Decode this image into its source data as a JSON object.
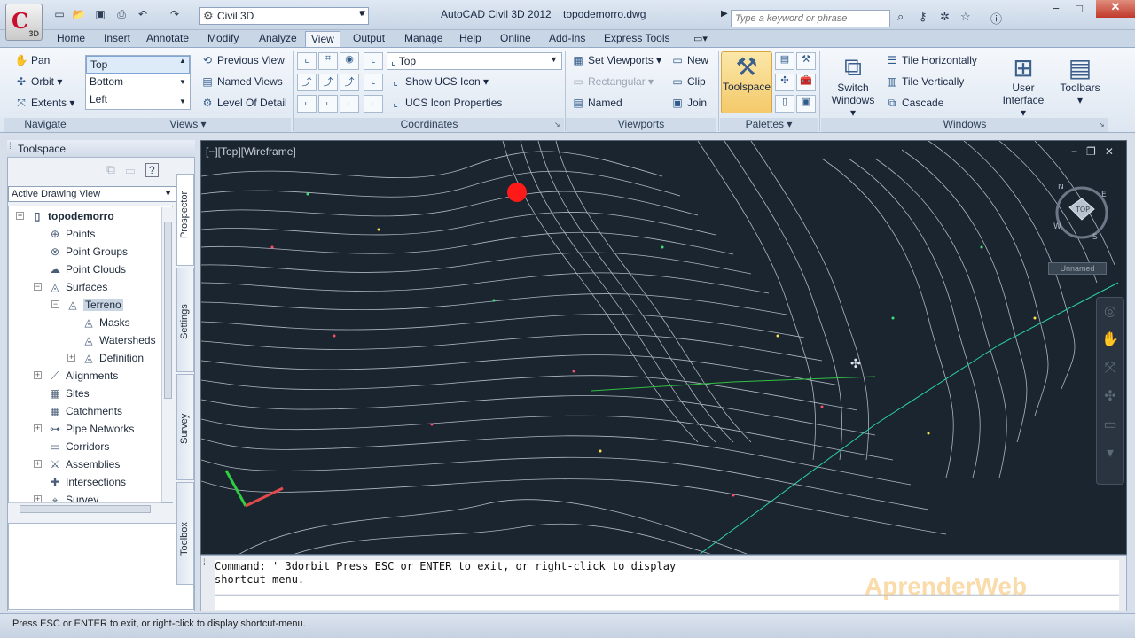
{
  "title": {
    "app": "AutoCAD Civil 3D 2012",
    "file": "topodemorro.dwg"
  },
  "app_button": {
    "tag": "3D"
  },
  "workspace": {
    "value": "Civil 3D"
  },
  "search": {
    "placeholder": "Type a keyword or phrase"
  },
  "tabs": [
    "Home",
    "Insert",
    "Annotate",
    "Modify",
    "Analyze",
    "View",
    "Output",
    "Manage",
    "Help",
    "Online",
    "Add-Ins",
    "Express Tools"
  ],
  "active_tab": "View",
  "ribbon": {
    "navigate": {
      "title": "Navigate",
      "pan": "Pan",
      "orbit": "Orbit",
      "extents": "Extents"
    },
    "views": {
      "title": "Views",
      "list": [
        "Top",
        "Bottom",
        "Left"
      ],
      "previous": "Previous View",
      "named": "Named Views",
      "level": "Level Of Detail"
    },
    "coordinates": {
      "title": "Coordinates",
      "ucs_value": "Top",
      "show_ucs": "Show UCS Icon",
      "ucs_props": "UCS Icon Properties"
    },
    "viewports": {
      "title": "Viewports",
      "set": "Set Viewports",
      "rect": "Rectangular",
      "named": "Named",
      "new": "New",
      "clip": "Clip",
      "join": "Join"
    },
    "palettes": {
      "title": "Palettes",
      "toolspace": "Toolspace"
    },
    "windows": {
      "title": "Windows",
      "switch": "Switch",
      "switch2": "Windows",
      "tile_h": "Tile Horizontally",
      "tile_v": "Tile Vertically",
      "cascade": "Cascade",
      "user": "User",
      "user2": "Interface",
      "toolbars": "Toolbars"
    }
  },
  "toolspace": {
    "title": "Toolspace",
    "view": "Active Drawing View",
    "tree": [
      {
        "label": "topodemorro",
        "icon": "drawing-icon"
      },
      {
        "label": "Points",
        "icon": "points-icon"
      },
      {
        "label": "Point Groups",
        "icon": "point-groups-icon"
      },
      {
        "label": "Point Clouds",
        "icon": "point-clouds-icon"
      },
      {
        "label": "Surfaces",
        "icon": "surfaces-icon"
      },
      {
        "label": "Terreno",
        "icon": "surface-icon"
      },
      {
        "label": "Masks",
        "icon": "masks-icon"
      },
      {
        "label": "Watersheds",
        "icon": "watersheds-icon"
      },
      {
        "label": "Definition",
        "icon": "definition-icon"
      },
      {
        "label": "Alignments",
        "icon": "alignments-icon"
      },
      {
        "label": "Sites",
        "icon": "sites-icon"
      },
      {
        "label": "Catchments",
        "icon": "catchments-icon"
      },
      {
        "label": "Pipe Networks",
        "icon": "pipe-networks-icon"
      },
      {
        "label": "Corridors",
        "icon": "corridors-icon"
      },
      {
        "label": "Assemblies",
        "icon": "assemblies-icon"
      },
      {
        "label": "Intersections",
        "icon": "intersections-icon"
      },
      {
        "label": "Survey",
        "icon": "survey-icon"
      }
    ],
    "tabs": [
      "Prospector",
      "Settings",
      "Survey",
      "Toolbox"
    ]
  },
  "viewport": {
    "label": "[−][Top][Wireframe]",
    "unnamed": "Unnamed",
    "cube_face": "TOP",
    "compass": [
      "N",
      "E",
      "S",
      "W"
    ]
  },
  "command": {
    "line1": "Command: '_3dorbit Press ESC or ENTER to exit, or right-click to display",
    "line2": "shortcut-menu."
  },
  "watermark": "AprenderWeb",
  "status": "Press ESC or ENTER to exit, or right-click to display shortcut-menu."
}
